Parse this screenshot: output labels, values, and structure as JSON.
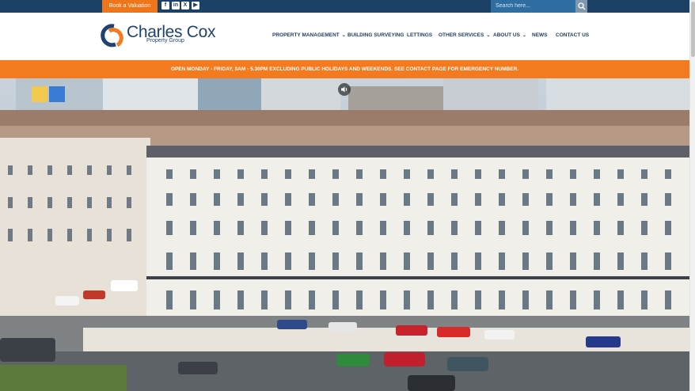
{
  "topbar": {
    "valuation_label": "Book a Valuation",
    "social_icons": [
      "facebook-icon",
      "linkedin-icon",
      "x-icon",
      "youtube-icon"
    ],
    "search_placeholder": "Search here..."
  },
  "logo": {
    "name": "Charles Cox",
    "subtitle": "Property Group"
  },
  "nav": {
    "items": [
      {
        "label": "PROPERTY MANAGEMENT",
        "dropdown": true
      },
      {
        "label": "BUILDING SURVEYING",
        "dropdown": false
      },
      {
        "label": "LETTINGS",
        "dropdown": false
      },
      {
        "label": "OTHER SERVICES",
        "dropdown": true
      },
      {
        "label": "ABOUT US",
        "dropdown": true
      },
      {
        "label": "NEWS",
        "dropdown": false
      },
      {
        "label": "CONTACT US",
        "dropdown": false
      }
    ]
  },
  "notice": {
    "text": "OPEN MONDAY - FRIDAY, 9AM - 5.30PM EXCLUDING PUBLIC HOLIDAYS AND WEEKENDS. SEE CONTACT PAGE FOR EMERGENCY NUMBER."
  },
  "hero": {
    "mute_icon": "speaker-icon"
  },
  "colors": {
    "navy": "#1b4166",
    "orange": "#f47a1f",
    "search": "#2e6ea3"
  }
}
